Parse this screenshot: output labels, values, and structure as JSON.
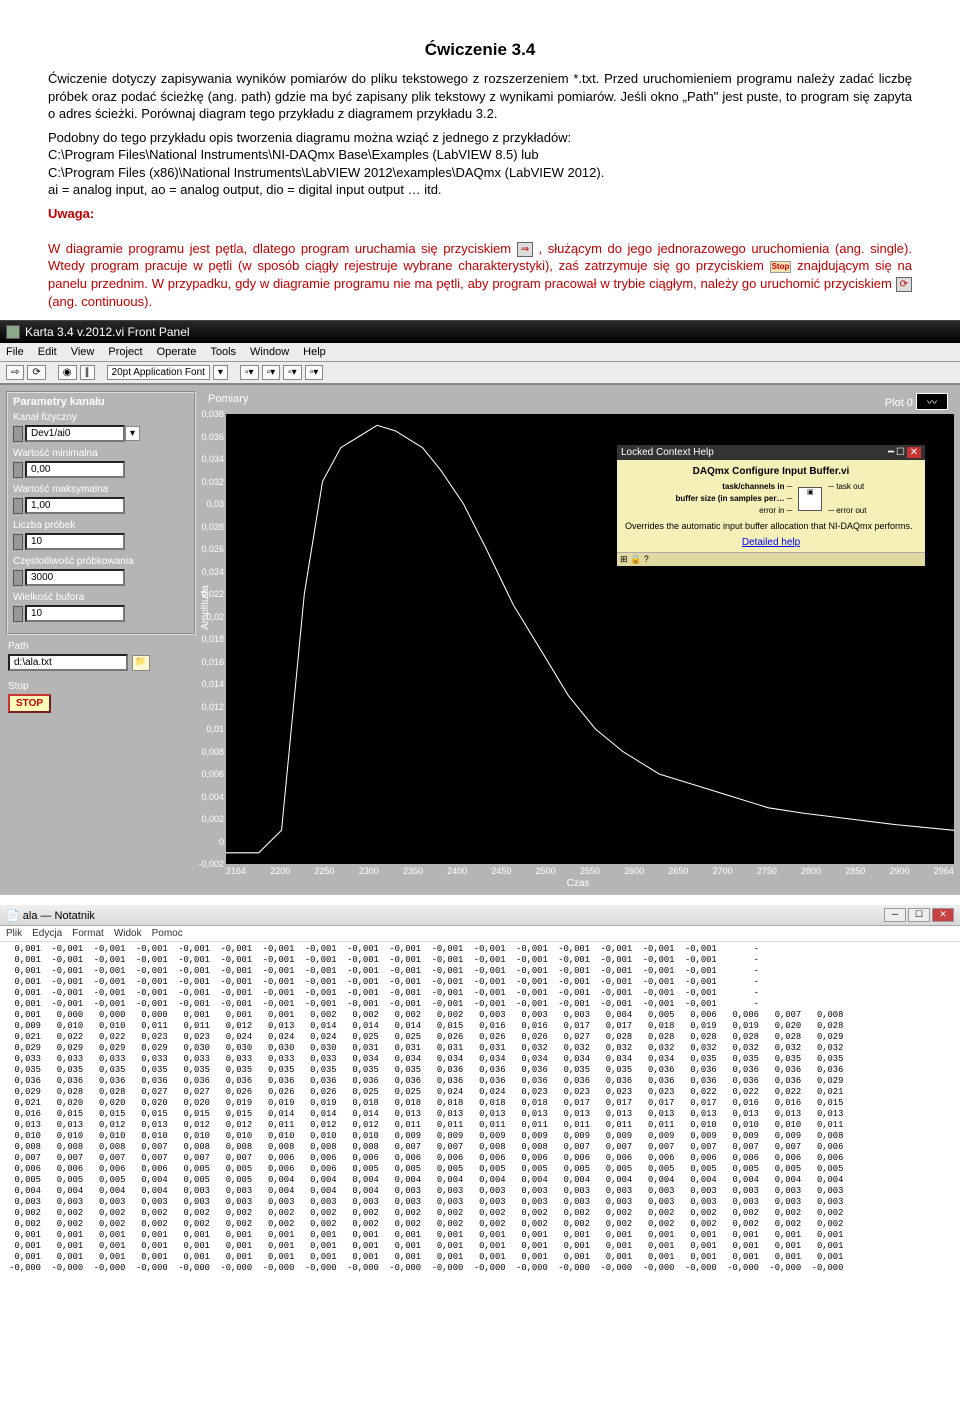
{
  "doc": {
    "title": "Ćwiczenie 3.4",
    "para1": "Ćwiczenie dotyczy zapisywania wyników pomiarów do pliku tekstowego z rozszerzeniem *.txt. Przed uruchomieniem programu należy zadać liczbę próbek oraz podać ścieżkę (ang. path) gdzie ma być zapisany plik tekstowy z wynikami pomiarów. Jeśli okno „Path\" jest puste, to program się zapyta o adres ścieżki. Porównaj diagram tego przykładu z diagramem przykładu 3.2.",
    "para2a": "Podobny do tego przykładu opis tworzenia diagramu można wziąć z jednego z przykładów:",
    "para2b": "C:\\Program Files\\National Instruments\\NI-DAQmx Base\\Examples (LabVIEW 8.5) lub",
    "para2c": "C:\\Program Files (x86)\\National Instruments\\LabVIEW 2012\\examples\\DAQmx (LabVIEW 2012).",
    "para2d": "ai = analog input, ao = analog output, dio = digital input output … itd.",
    "uwaga": "Uwaga:",
    "red1a": "W diagramie programu jest pętla, dlatego program uruchamia się przyciskiem ",
    "red1b": ", służącym do jego jednorazowego uruchomienia (ang. single). Wtedy program pracuje w pętli (w sposób ciągły rejestruje wybrane charakterystyki), zaś zatrzymuje się go przyciskiem ",
    "red1c": " znajdującym się na panelu przednim. W przypadku, gdy w diagramie programu nie ma pętli, aby program pracował w trybie ciągłym, należy go uruchomić przyciskiem ",
    "red1d": " (ang. continuous).",
    "run_arrow": "⇒",
    "stop_label": "Stop",
    "cont_arrow": "⟳"
  },
  "labview": {
    "window_title": "Karta 3.4 v.2012.vi Front Panel",
    "menu": [
      "File",
      "Edit",
      "View",
      "Project",
      "Operate",
      "Tools",
      "Window",
      "Help"
    ],
    "toolbar_font": "20pt Application Font",
    "params_title": "Parametry kanału",
    "fields": {
      "kanal_lbl": "Kanał fizyczny",
      "kanal_val": "Dev1/ai0",
      "min_lbl": "Wartość minimalna",
      "min_val": "0,00",
      "max_lbl": "Wartość maksymalna",
      "max_val": "1,00",
      "probek_lbl": "Liczba próbek",
      "probek_val": "10",
      "freq_lbl": "Częstotliwość próbkowania",
      "freq_val": "3000",
      "bufor_lbl": "Wielkość bufora",
      "bufor_val": "10",
      "path_lbl": "Path",
      "path_val": "d:\\ala.txt",
      "stop_lbl": "Stop",
      "stop_btn": "STOP"
    },
    "chart": {
      "title": "Pomiary",
      "plot_label": "Plot 0",
      "y_label": "Amplituda",
      "x_label": "Czas"
    },
    "ctx_help": {
      "bar": "Locked Context Help",
      "title": "DAQmx Configure Input Buffer.vi",
      "task_in": "task/channels in",
      "buf": "buffer size (in samples per…",
      "err_in": "error in",
      "task_out": "task out",
      "err_out": "error out",
      "desc": "Overrides the automatic input buffer allocation that NI-DAQmx performs.",
      "link": "Detailed help",
      "foot": "⊞ 🔒 ?"
    }
  },
  "notepad": {
    "title": "ala — Notatnik",
    "menu": [
      "Plik",
      "Edycja",
      "Format",
      "Widok",
      "Pomoc"
    ]
  },
  "chart_data": {
    "type": "line",
    "title": "Pomiary",
    "xlabel": "Czas",
    "ylabel": "Amplituda",
    "xlim": [
      2164,
      2964
    ],
    "ylim": [
      -0.002,
      0.038
    ],
    "x_ticks": [
      2164,
      2200,
      2250,
      2300,
      2350,
      2400,
      2450,
      2500,
      2550,
      2600,
      2650,
      2700,
      2750,
      2800,
      2850,
      2900,
      2964
    ],
    "y_ticks": [
      -0.002,
      0,
      0.002,
      0.004,
      0.006,
      0.008,
      0.01,
      0.012,
      0.014,
      0.016,
      0.018,
      0.02,
      0.022,
      0.024,
      0.026,
      0.028,
      0.03,
      0.032,
      0.034,
      0.036,
      0.038
    ],
    "x": [
      2164,
      2200,
      2225,
      2250,
      2270,
      2290,
      2310,
      2330,
      2350,
      2380,
      2400,
      2425,
      2450,
      2480,
      2510,
      2540,
      2570,
      2600,
      2640,
      2680,
      2720,
      2760,
      2800,
      2850,
      2900,
      2964
    ],
    "y": [
      -0.001,
      -0.001,
      0.001,
      0.022,
      0.032,
      0.035,
      0.036,
      0.037,
      0.0365,
      0.035,
      0.033,
      0.03,
      0.026,
      0.021,
      0.017,
      0.013,
      0.01,
      0.008,
      0.006,
      0.005,
      0.004,
      0.003,
      0.0025,
      0.002,
      0.0015,
      0.001
    ]
  },
  "notepad_data": {
    "cols": 18,
    "rows": [
      [
        "0,001",
        "-0,001",
        "-0,001",
        "-0,001",
        "-0,001",
        "-0,001",
        "-0,001",
        "-0,001",
        "-0,001",
        "-0,001",
        "-0,001",
        "-0,001",
        "-0,001",
        "-0,001",
        "-0,001",
        "-0,001",
        "-0,001",
        "-"
      ],
      [
        "0,001",
        "-0,001",
        "-0,001",
        "-0,001",
        "-0,001",
        "-0,001",
        "-0,001",
        "-0,001",
        "-0,001",
        "-0,001",
        "-0,001",
        "-0,001",
        "-0,001",
        "-0,001",
        "-0,001",
        "-0,001",
        "-0,001",
        "-"
      ],
      [
        "0,001",
        "-0,001",
        "-0,001",
        "-0,001",
        "-0,001",
        "-0,001",
        "-0,001",
        "-0,001",
        "-0,001",
        "-0,001",
        "-0,001",
        "-0,001",
        "-0,001",
        "-0,001",
        "-0,001",
        "-0,001",
        "-0,001",
        "-"
      ],
      [
        "0,001",
        "-0,001",
        "-0,001",
        "-0,001",
        "-0,001",
        "-0,001",
        "-0,001",
        "-0,001",
        "-0,001",
        "-0,001",
        "-0,001",
        "-0,001",
        "-0,001",
        "-0,001",
        "-0,001",
        "-0,001",
        "-0,001",
        "-"
      ],
      [
        "0,001",
        "-0,001",
        "-0,001",
        "-0,001",
        "-0,001",
        "-0,001",
        "-0,001",
        "-0,001",
        "-0,001",
        "-0,001",
        "-0,001",
        "-0,001",
        "-0,001",
        "-0,001",
        "-0,001",
        "-0,001",
        "-0,001",
        "-"
      ],
      [
        "0,001",
        "-0,001",
        "-0,001",
        "-0,001",
        "-0,001",
        "-0,001",
        "-0,001",
        "-0,001",
        "-0,001",
        "-0,001",
        "-0,001",
        "-0,001",
        "-0,001",
        "-0,001",
        "-0,001",
        "-0,001",
        "-0,001",
        "-"
      ],
      [
        "0,001",
        "0,000",
        "0,000",
        "0,000",
        "0,001",
        "0,001",
        "0,001",
        "0,002",
        "0,002",
        "0,002",
        "0,002",
        "0,003",
        "0,003",
        "0,003",
        "0,004",
        "0,005",
        "0,006",
        "0,006",
        "0,007",
        "0,008"
      ],
      [
        "0,009",
        "0,010",
        "0,010",
        "0,011",
        "0,011",
        "0,012",
        "0,013",
        "0,014",
        "0,014",
        "0,014",
        "0,015",
        "0,016",
        "0,016",
        "0,017",
        "0,017",
        "0,018",
        "0,019",
        "0,019",
        "0,020",
        "0,028"
      ],
      [
        "0,021",
        "0,022",
        "0,022",
        "0,023",
        "0,023",
        "0,024",
        "0,024",
        "0,024",
        "0,025",
        "0,025",
        "0,026",
        "0,026",
        "0,026",
        "0,027",
        "0,028",
        "0,028",
        "0,028",
        "0,028",
        "0,028",
        "0,029"
      ],
      [
        "0,029",
        "0,029",
        "0,029",
        "0,029",
        "0,030",
        "0,030",
        "0,030",
        "0,030",
        "0,031",
        "0,031",
        "0,031",
        "0,031",
        "0,032",
        "0,032",
        "0,032",
        "0,032",
        "0,032",
        "0,032",
        "0,032",
        "0,032"
      ],
      [
        "0,033",
        "0,033",
        "0,033",
        "0,033",
        "0,033",
        "0,033",
        "0,033",
        "0,033",
        "0,034",
        "0,034",
        "0,034",
        "0,034",
        "0,034",
        "0,034",
        "0,034",
        "0,034",
        "0,035",
        "0,035",
        "0,035",
        "0,035"
      ],
      [
        "0,035",
        "0,035",
        "0,035",
        "0,035",
        "0,035",
        "0,035",
        "0,035",
        "0,035",
        "0,035",
        "0,035",
        "0,036",
        "0,036",
        "0,036",
        "0,035",
        "0,035",
        "0,036",
        "0,036",
        "0,036",
        "0,036",
        "0,036"
      ],
      [
        "0,036",
        "0,036",
        "0,036",
        "0,036",
        "0,036",
        "0,036",
        "0,036",
        "0,036",
        "0,036",
        "0,036",
        "0,036",
        "0,036",
        "0,036",
        "0,036",
        "0,036",
        "0,036",
        "0,036",
        "0,036",
        "0,036",
        "0,029"
      ],
      [
        "0,029",
        "0,028",
        "0,028",
        "0,027",
        "0,027",
        "0,026",
        "0,026",
        "0,026",
        "0,025",
        "0,025",
        "0,024",
        "0,024",
        "0,023",
        "0,023",
        "0,023",
        "0,023",
        "0,022",
        "0,022",
        "0,022",
        "0,021"
      ],
      [
        "0,021",
        "0,020",
        "0,020",
        "0,020",
        "0,020",
        "0,019",
        "0,019",
        "0,019",
        "0,018",
        "0,018",
        "0,018",
        "0,018",
        "0,018",
        "0,017",
        "0,017",
        "0,017",
        "0,017",
        "0,016",
        "0,016",
        "0,015"
      ],
      [
        "0,016",
        "0,015",
        "0,015",
        "0,015",
        "0,015",
        "0,015",
        "0,014",
        "0,014",
        "0,014",
        "0,013",
        "0,013",
        "0,013",
        "0,013",
        "0,013",
        "0,013",
        "0,013",
        "0,013",
        "0,013",
        "0,013",
        "0,013"
      ],
      [
        "0,013",
        "0,013",
        "0,012",
        "0,013",
        "0,012",
        "0,012",
        "0,011",
        "0,012",
        "0,012",
        "0,011",
        "0,011",
        "0,011",
        "0,011",
        "0,011",
        "0,011",
        "0,011",
        "0,010",
        "0,010",
        "0,010",
        "0,011"
      ],
      [
        "0,010",
        "0,010",
        "0,010",
        "0,010",
        "0,010",
        "0,010",
        "0,010",
        "0,010",
        "0,010",
        "0,009",
        "0,009",
        "0,009",
        "0,009",
        "0,009",
        "0,009",
        "0,009",
        "0,009",
        "0,009",
        "0,009",
        "0,008"
      ],
      [
        "0,008",
        "0,008",
        "0,008",
        "0,007",
        "0,008",
        "0,008",
        "0,008",
        "0,008",
        "0,008",
        "0,007",
        "0,007",
        "0,008",
        "0,008",
        "0,007",
        "0,007",
        "0,007",
        "0,007",
        "0,007",
        "0,007",
        "0,006"
      ],
      [
        "0,007",
        "0,007",
        "0,007",
        "0,007",
        "0,007",
        "0,007",
        "0,006",
        "0,006",
        "0,006",
        "0,006",
        "0,006",
        "0,006",
        "0,006",
        "0,006",
        "0,006",
        "0,006",
        "0,006",
        "0,006",
        "0,006",
        "0,006"
      ],
      [
        "0,006",
        "0,006",
        "0,006",
        "0,006",
        "0,005",
        "0,005",
        "0,006",
        "0,006",
        "0,005",
        "0,005",
        "0,005",
        "0,005",
        "0,005",
        "0,005",
        "0,005",
        "0,005",
        "0,005",
        "0,005",
        "0,005",
        "0,005"
      ],
      [
        "0,005",
        "0,005",
        "0,005",
        "0,004",
        "0,005",
        "0,005",
        "0,004",
        "0,004",
        "0,004",
        "0,004",
        "0,004",
        "0,004",
        "0,004",
        "0,004",
        "0,004",
        "0,004",
        "0,004",
        "0,004",
        "0,004",
        "0,004"
      ],
      [
        "0,004",
        "0,004",
        "0,004",
        "0,004",
        "0,003",
        "0,003",
        "0,004",
        "0,004",
        "0,004",
        "0,003",
        "0,003",
        "0,003",
        "0,003",
        "0,003",
        "0,003",
        "0,003",
        "0,003",
        "0,003",
        "0,003",
        "0,003"
      ],
      [
        "0,003",
        "0,003",
        "0,003",
        "0,003",
        "0,003",
        "0,003",
        "0,003",
        "0,003",
        "0,003",
        "0,003",
        "0,003",
        "0,003",
        "0,003",
        "0,003",
        "0,003",
        "0,003",
        "0,003",
        "0,003",
        "0,003",
        "0,003"
      ],
      [
        "0,002",
        "0,002",
        "0,002",
        "0,002",
        "0,002",
        "0,002",
        "0,002",
        "0,002",
        "0,002",
        "0,002",
        "0,002",
        "0,002",
        "0,002",
        "0,002",
        "0,002",
        "0,002",
        "0,002",
        "0,002",
        "0,002",
        "0,002"
      ],
      [
        "0,002",
        "0,002",
        "0,002",
        "0,002",
        "0,002",
        "0,002",
        "0,002",
        "0,002",
        "0,002",
        "0,002",
        "0,002",
        "0,002",
        "0,002",
        "0,002",
        "0,002",
        "0,002",
        "0,002",
        "0,002",
        "0,002",
        "0,002"
      ],
      [
        "0,001",
        "0,001",
        "0,001",
        "0,001",
        "0,001",
        "0,001",
        "0,001",
        "0,001",
        "0,001",
        "0,001",
        "0,001",
        "0,001",
        "0,001",
        "0,001",
        "0,001",
        "0,001",
        "0,001",
        "0,001",
        "0,001",
        "0,001"
      ],
      [
        "0,001",
        "0,001",
        "0,001",
        "0,001",
        "0,001",
        "0,001",
        "0,001",
        "0,001",
        "0,001",
        "0,001",
        "0,001",
        "0,001",
        "0,001",
        "0,001",
        "0,001",
        "0,001",
        "0,001",
        "0,001",
        "0,001",
        "0,001"
      ],
      [
        "0,001",
        "0,001",
        "0,001",
        "0,001",
        "0,001",
        "0,001",
        "0,001",
        "0,001",
        "0,001",
        "0,001",
        "0,001",
        "0,001",
        "0,001",
        "0,001",
        "0,001",
        "0,001",
        "0,001",
        "0,001",
        "0,001",
        "0,001"
      ],
      [
        "-0,000",
        "-0,000",
        "-0,000",
        "-0,000",
        "-0,000",
        "-0,000",
        "-0,000",
        "-0,000",
        "-0,000",
        "-0,000",
        "-0,000",
        "-0,000",
        "-0,000",
        "-0,000",
        "-0,000",
        "-0,000",
        "-0,000",
        "-0,000",
        "-0,000",
        "-0,000"
      ]
    ]
  }
}
